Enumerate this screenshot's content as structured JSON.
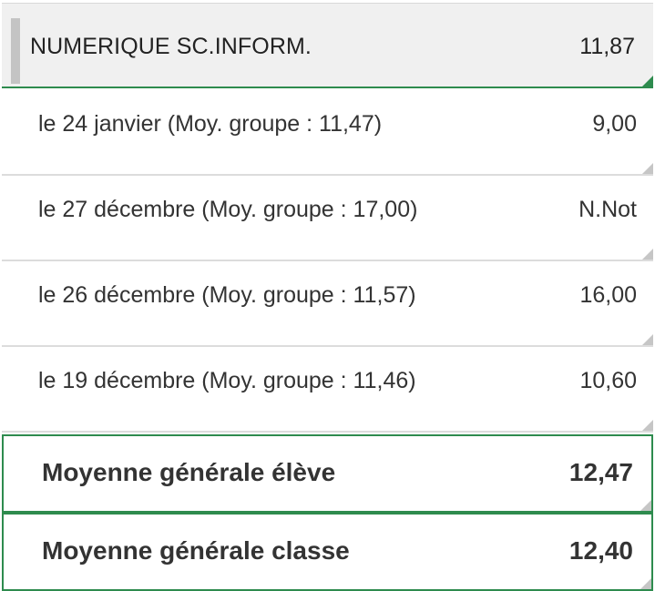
{
  "subject": {
    "name": "NUMERIQUE SC.INFORM.",
    "average": "11,87"
  },
  "grades": [
    {
      "label": "le 24 janvier (Moy. groupe : 11,47)",
      "value": "9,00"
    },
    {
      "label": "le 27 décembre (Moy. groupe : 17,00)",
      "value": "N.Not"
    },
    {
      "label": "le 26 décembre (Moy. groupe : 11,57)",
      "value": "16,00"
    },
    {
      "label": "le 19 décembre (Moy. groupe : 11,46)",
      "value": "10,60"
    }
  ],
  "summary": {
    "student_label": "Moyenne générale élève",
    "student_value": "12,47",
    "class_label": "Moyenne générale classe",
    "class_value": "12,40"
  },
  "colors": {
    "accent_green": "#2e8b4e",
    "header_bg": "#f0f0f0"
  }
}
